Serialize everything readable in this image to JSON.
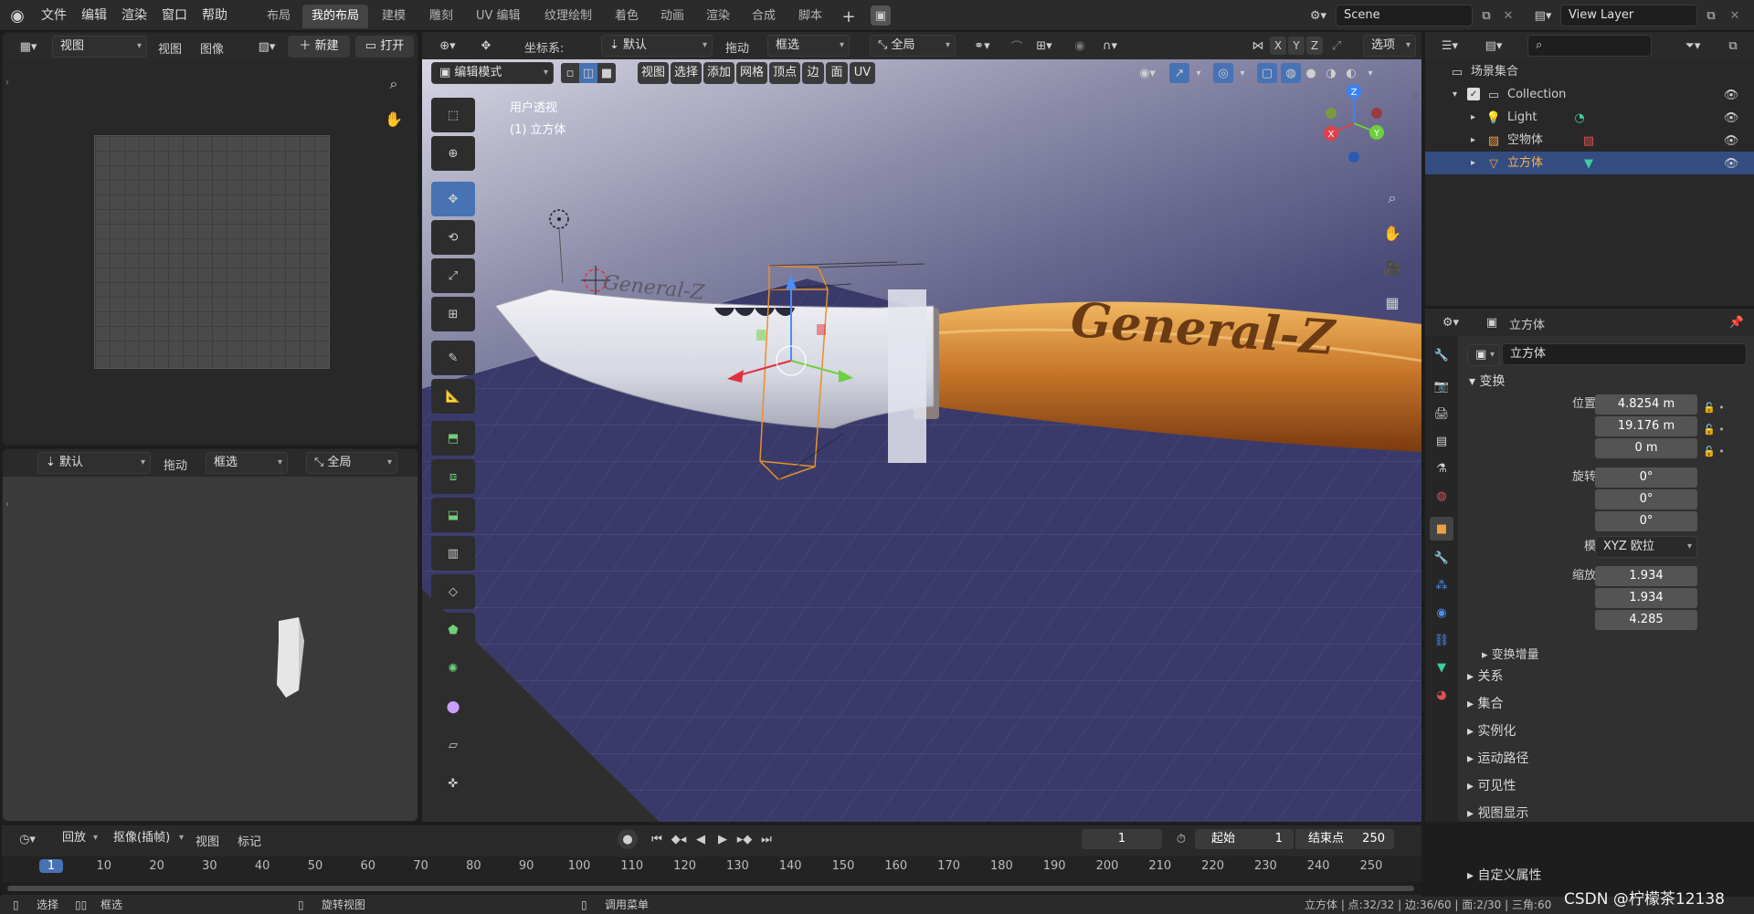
{
  "topbar": {
    "menus": [
      "文件",
      "编辑",
      "渲染",
      "窗口",
      "帮助"
    ],
    "workspaces": [
      "布局",
      "我的布局",
      "建模",
      "雕刻",
      "UV 编辑",
      "纹理绘制",
      "着色",
      "动画",
      "渲染",
      "合成",
      "脚本"
    ],
    "active_workspace": "我的布局",
    "scene": "Scene",
    "view_layer": "View Layer"
  },
  "image_editor": {
    "view_label": "视图",
    "menus": [
      "视图",
      "图像"
    ],
    "new_label": "新建",
    "open_label": "打开"
  },
  "preview_panel": {
    "transform": "默认",
    "drag": "拖动",
    "select": "框选",
    "orient": "全局"
  },
  "viewport": {
    "coord_label": "坐标系:",
    "coord_value": "默认",
    "drag_label": "拖动",
    "select_value": "框选",
    "orient_value": "全局",
    "options_label": "选项",
    "mode": "编辑模式",
    "menus": [
      "视图",
      "选择",
      "添加",
      "网格",
      "顶点",
      "边",
      "面",
      "UV"
    ],
    "overlay_title": "用户透视",
    "overlay_object": "(1) 立方体",
    "axes": [
      "X",
      "Y",
      "Z"
    ],
    "engraving": "General-Z"
  },
  "outliner": {
    "root": "场景集合",
    "collection": "Collection",
    "items": [
      {
        "name": "Light"
      },
      {
        "name": "空物体"
      },
      {
        "name": "立方体"
      }
    ]
  },
  "properties": {
    "header_name": "立方体",
    "object_name": "立方体",
    "section": "变换",
    "loc_label": "位置",
    "rot_label": "旋转",
    "scale_label": "缩放",
    "location": [
      "4.8254 m",
      "19.176 m",
      "0 m"
    ],
    "rotation": [
      "0°",
      "0°",
      "0°"
    ],
    "mode_label": "模式",
    "mode_value": "XYZ 欧拉",
    "scale": [
      "1.934",
      "1.934",
      "4.285"
    ],
    "axis_letters": [
      "X",
      "Y",
      "Z"
    ],
    "delta": "变换增量",
    "subsections": [
      "关系",
      "集合",
      "实例化",
      "运动路径",
      "可见性",
      "视图显示",
      "自定义属性"
    ]
  },
  "timeline": {
    "playback": "回放",
    "keying": "抠像(插帧)",
    "menus": [
      "视图",
      "标记"
    ],
    "current_frame": "1",
    "start_label": "起始",
    "start": "1",
    "end_label": "结束点",
    "end": "250",
    "ticks": [
      "1",
      "10",
      "20",
      "30",
      "40",
      "50",
      "60",
      "70",
      "80",
      "90",
      "100",
      "110",
      "120",
      "130",
      "140",
      "150",
      "160",
      "170",
      "180",
      "190",
      "200",
      "210",
      "220",
      "230",
      "240",
      "250"
    ]
  },
  "statusbar": {
    "select": "选择",
    "box_select": "框选",
    "rotate_view": "旋转视图",
    "call_menu": "调用菜单",
    "stats": "立方体 | 点:32/32 | 边:36/60 | 面:2/30 | 三角:60",
    "watermark": "CSDN @柠檬茶12138"
  },
  "colors": {
    "accent": "#4772b3",
    "handle": "#c88a3a",
    "blade": "#d9dce4",
    "bg_floor": "#3a3a6a"
  }
}
